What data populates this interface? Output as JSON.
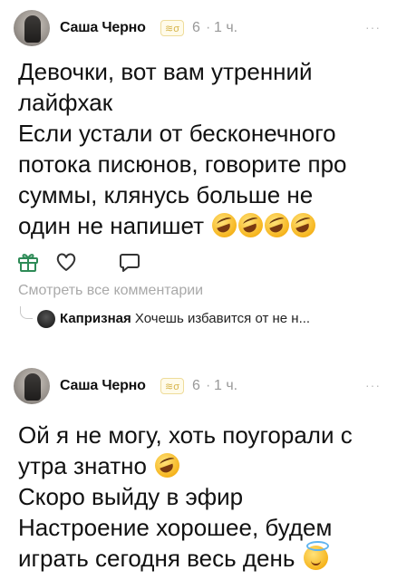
{
  "post1": {
    "author": "Саша Черно",
    "badge": "≋σ",
    "level": "6",
    "separator": "·",
    "time": "1 ч.",
    "more": "···",
    "lines": [
      "Девочки, вот вам утренний",
      "лайфхак",
      "Если устали от бесконечного",
      "потока писюнов, говорите про",
      "суммы, клянусь больше не",
      "один не напишет"
    ],
    "emoji_end": [
      "rofl",
      "rofl",
      "rofl",
      "rofl"
    ],
    "actions": [
      "gift-icon",
      "heart-icon",
      "comment-icon"
    ],
    "view_comments": "Смотреть все комментарии",
    "top_comment": {
      "author": "Капризная",
      "text": "Хочешь избавится от не н..."
    }
  },
  "post2": {
    "author": "Саша Черно",
    "badge": "≋σ",
    "level": "6",
    "separator": "·",
    "time": "1 ч.",
    "more": "···",
    "lines": [
      "Ой я не могу, хоть поугорали с",
      "утра знатно",
      "Скоро выйду в эфир",
      "Настроение хорошее, будем",
      "играть сегодня весь день"
    ],
    "emoji_after_line": {
      "1": "rofl",
      "4": "halo"
    }
  },
  "colors": {
    "text": "#111111",
    "muted": "#999999",
    "badge": "#d6b44a",
    "icon": "#333333"
  }
}
